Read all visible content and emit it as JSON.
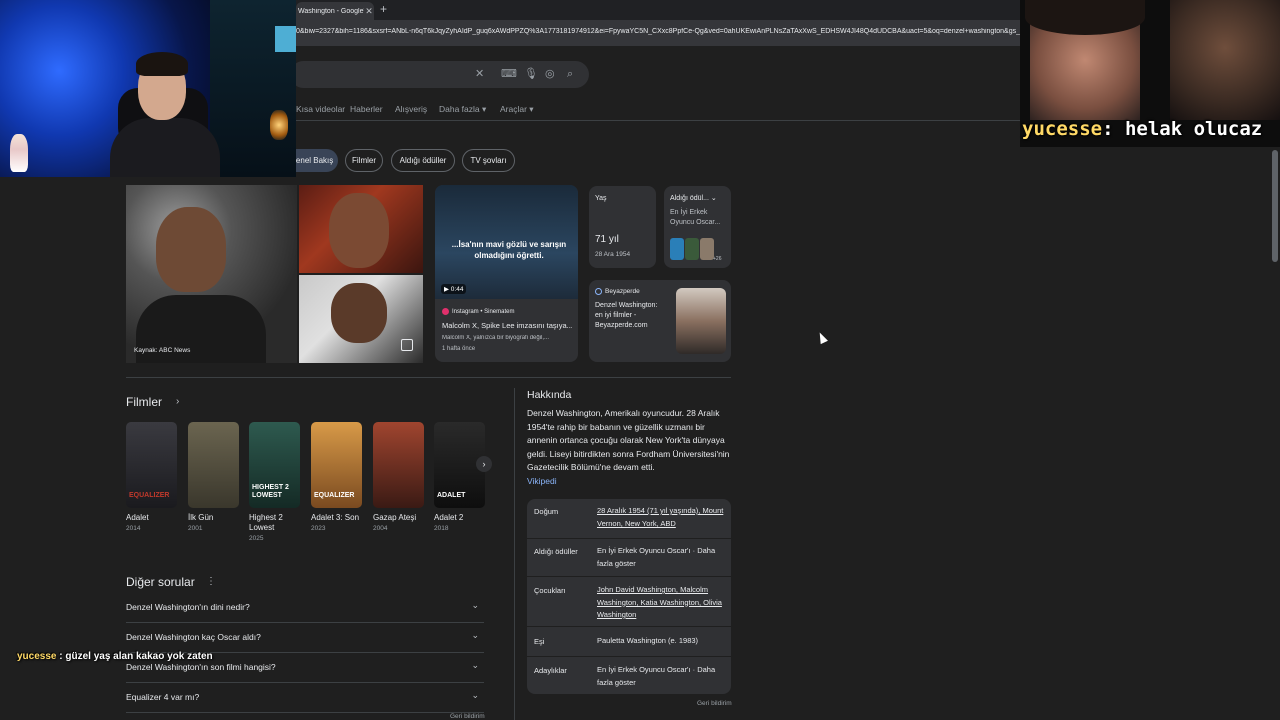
{
  "browser": {
    "tab_title": "Washington - Google'da",
    "tab_close": "✕",
    "new_tab": "+",
    "url": "0&biw=2327&bih=1186&sxsrf=ANbL-n6qT6kJqyZyhAIdP_guq6xAWdPPZQ%3A1773181974912&ei=FpywaYC5N_CXxc8PpfCe-Qg&ved=0ahUKEwiAnPLNsZaTAxXwS_EDHSW4JI48Q4dUDCBA&uact=5&oq=denzel+washington&gs_lp=E"
  },
  "search": {
    "icons": [
      "clear-icon",
      "keyboard-icon",
      "mic-icon",
      "lens-icon",
      "search-icon"
    ]
  },
  "nav": {
    "tabs": [
      "Kısa videolar",
      "Haberler",
      "Alışveriş",
      "Daha fazla ▾",
      "Araçlar ▾"
    ]
  },
  "chips": [
    "Genel Bakış",
    "Filmler",
    "Aldığı ödüller",
    "TV şovları"
  ],
  "images": {
    "main_caption": "Kaynak: ABC News"
  },
  "video": {
    "overlay": "...İsa'nın mavi gözlü ve sarışın olmadığını öğretti.",
    "duration": "▶ 0:44",
    "source": "Instagram • Sinematem",
    "title": "Malcolm X, Spike Lee imzasını taşıya...",
    "desc": "Malcolm X, yalnızca bir biyografi değil,...",
    "time": "1 hafta önce"
  },
  "age_card": {
    "label": "Yaş",
    "value": "71 yıl",
    "sub": "28 Ara 1954"
  },
  "award_card": {
    "label": "Aldığı ödül... ⌄",
    "sub": "En İyi Erkek Oyuncu Oscar...",
    "count": "+26"
  },
  "beyazperde_card": {
    "source": "Beyazperde",
    "text": "Denzel Washington: en iyi filmler - Beyazperde.com"
  },
  "films": {
    "title": "Filmler",
    "arrow": "›",
    "next": "›",
    "items": [
      {
        "name": "Adalet",
        "year": "2014",
        "poster_text": "EQUALIZER",
        "color": "#2a2a2e"
      },
      {
        "name": "İlk Gün",
        "year": "2001",
        "poster_text": "",
        "color": "#4a4638"
      },
      {
        "name": "Highest 2 Lowest",
        "year": "2025",
        "poster_text": "HIGHEST 2 LOWEST",
        "color": "#1f3b34"
      },
      {
        "name": "Adalet 3: Son",
        "year": "2023",
        "poster_text": "EQUALIZER",
        "color": "#c08a3a"
      },
      {
        "name": "Gazap Ateşi",
        "year": "2004",
        "poster_text": "",
        "color": "#8a3a2a"
      },
      {
        "name": "Adalet 2",
        "year": "2018",
        "poster_text": "ADALET",
        "color": "#202020"
      }
    ]
  },
  "questions": {
    "title": "Diğer sorular",
    "dots": "⋮",
    "items": [
      "Denzel Washington'ın dini nedir?",
      "Denzel Washington kaç Oscar aldı?",
      "Denzel Washington'ın son filmi hangisi?",
      "Equalizer 4 var mı?"
    ],
    "feedback": "Geri bildirim"
  },
  "about": {
    "title": "Hakkında",
    "text": "Denzel Washington, Amerikalı oyuncudur. 28 Aralık 1954'te rahip bir babanın ve güzellik uzmanı bir annenin ortanca çocuğu olarak New York'ta dünyaya geldi. Liseyi bitirdikten sonra Fordham Üniversitesi'nin Gazetecilik Bölümü'ne devam etti.",
    "link": "Vikipedi",
    "facts": [
      {
        "key": "Doğum",
        "value": "28 Aralık 1954 (71 yıl yaşında), Mount Vernon, New York, ABD"
      },
      {
        "key": "Aldığı ödüller",
        "value": "En İyi Erkek Oyuncu Oscar'ı · Daha fazla göster"
      },
      {
        "key": "Çocukları",
        "value": "John David Washington, Malcolm Washington, Katia Washington, Olivia Washington"
      },
      {
        "key": "Eşi",
        "value": "Pauletta Washington (e. 1983)"
      },
      {
        "key": "Adaylıklar",
        "value": "En İyi Erkek Oyuncu Oscar'ı · Daha fazla göster"
      }
    ],
    "feedback": "Geri bildirim"
  },
  "stream": {
    "overlay_user": "yucesse",
    "overlay_msg": ": helak olucaz",
    "chat_user": "yucesse",
    "chat_msg": " : güzel yaş alan kakao yok zaten"
  }
}
